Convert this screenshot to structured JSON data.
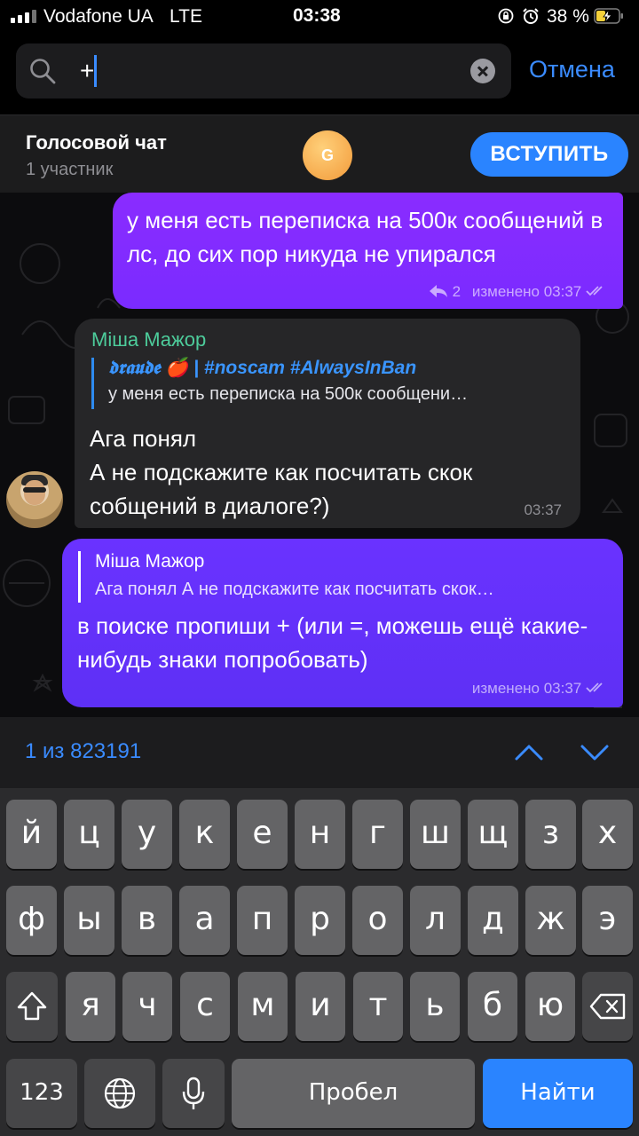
{
  "status_bar": {
    "carrier": "Vodafone UA",
    "network": "LTE",
    "time": "03:38",
    "battery": "38 %"
  },
  "search": {
    "value": "+",
    "cancel_label": "Отмена"
  },
  "voice_chat": {
    "title": "Голосовой чат",
    "subtitle": "1 участник",
    "avatar_letter": "G",
    "join_label": "ВСТУПИТЬ"
  },
  "messages": [
    {
      "text": "у меня есть переписка на 500к сообщений в лс, до сих пор никуда не упирался",
      "replies": "2",
      "meta": "изменено 03:37"
    },
    {
      "sender": "Міша Мажор",
      "quote_name": "𝖉𝖗𝖆𝖚𝖉𝖊 🍎 | #noscam #AlwaysInBan",
      "quote_text": "у меня есть переписка на 500к сообщени…",
      "text_line1": "Ага понял",
      "text_line2": "А не подскажите как посчитать скок собщений в диалоге?)",
      "time": "03:37"
    },
    {
      "quote_name": "Міша Мажор",
      "quote_text": "Ага понял А не подскажите как посчитать скок…",
      "text": "в поиске пропиши + (или =, можешь ещё какие-нибудь знаки попробовать)",
      "meta": "изменено 03:37"
    }
  ],
  "results": {
    "count": "1 из 823191"
  },
  "keyboard": {
    "row1": [
      "й",
      "ц",
      "у",
      "к",
      "е",
      "н",
      "г",
      "ш",
      "щ",
      "з",
      "х"
    ],
    "row2": [
      "ф",
      "ы",
      "в",
      "а",
      "п",
      "р",
      "о",
      "л",
      "д",
      "ж",
      "э"
    ],
    "row3": [
      "я",
      "ч",
      "с",
      "м",
      "и",
      "т",
      "ь",
      "б",
      "ю"
    ],
    "numbers_label": "123",
    "space_label": "Пробел",
    "action_label": "Найти"
  },
  "colors": {
    "accent": "#2a84ff",
    "outgoing_bubble": "#7a2bff",
    "incoming_bubble": "#262628",
    "sender_name": "#4dcc9b"
  }
}
